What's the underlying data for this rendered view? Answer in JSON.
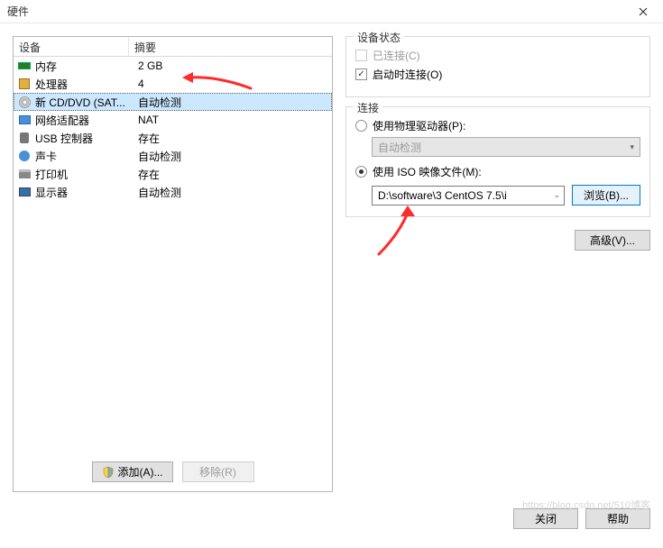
{
  "window": {
    "title": "硬件"
  },
  "table": {
    "headers": {
      "device": "设备",
      "summary": "摘要"
    },
    "rows": [
      {
        "icon": "mem",
        "device": "内存",
        "summary": "2 GB",
        "selected": false
      },
      {
        "icon": "cpu",
        "device": "处理器",
        "summary": "4",
        "selected": false
      },
      {
        "icon": "cd",
        "device": "新 CD/DVD (SAT...",
        "summary": "自动检测",
        "selected": true
      },
      {
        "icon": "net",
        "device": "网络适配器",
        "summary": "NAT",
        "selected": false
      },
      {
        "icon": "usb",
        "device": "USB 控制器",
        "summary": "存在",
        "selected": false
      },
      {
        "icon": "snd",
        "device": "声卡",
        "summary": "自动检测",
        "selected": false
      },
      {
        "icon": "prt",
        "device": "打印机",
        "summary": "存在",
        "selected": false
      },
      {
        "icon": "dsp",
        "device": "显示器",
        "summary": "自动检测",
        "selected": false
      }
    ]
  },
  "left_buttons": {
    "add": "添加(A)...",
    "remove": "移除(R)"
  },
  "device_state": {
    "legend": "设备状态",
    "connected": {
      "label": "已连接(C)",
      "checked": false,
      "disabled": true
    },
    "connect_at_power": {
      "label": "启动时连接(O)",
      "checked": true,
      "disabled": false
    }
  },
  "connection": {
    "legend": "连接",
    "physical": {
      "label": "使用物理驱动器(P):",
      "selected": false
    },
    "physical_drive_value": "自动检测",
    "iso": {
      "label": "使用 ISO 映像文件(M):",
      "selected": true
    },
    "iso_path": "D:\\software\\3 CentOS 7.5\\i",
    "browse": "浏览(B)..."
  },
  "advanced": "高级(V)...",
  "footer": {
    "close": "关闭",
    "help": "帮助"
  },
  "watermark": "https://blog.csdn.net/510博客"
}
